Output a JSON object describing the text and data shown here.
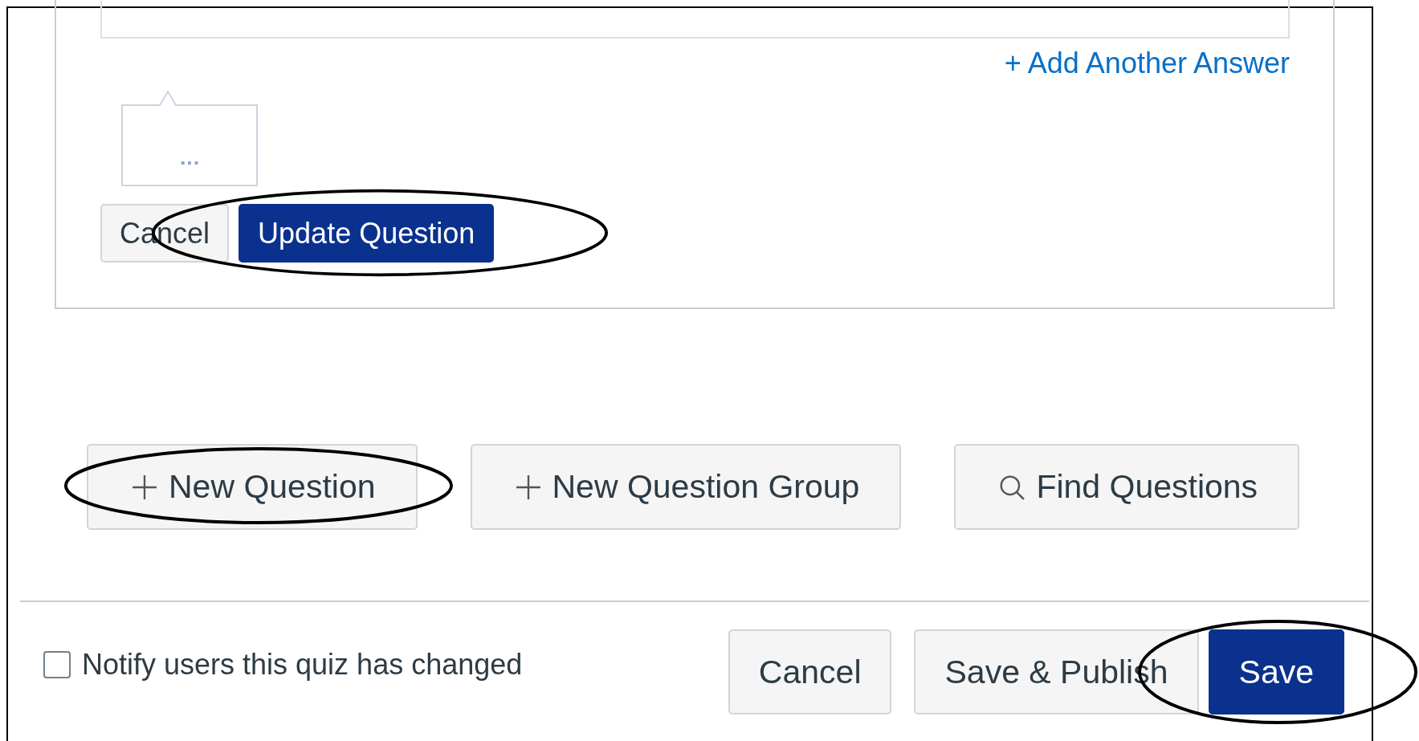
{
  "question_editor": {
    "add_answer_link": "+ Add Another Answer",
    "tooltip_text": "...",
    "buttons": [
      {
        "label": "Cancel",
        "kind": "secondary",
        "highlighted": false
      },
      {
        "label": "Update Question",
        "kind": "primary",
        "highlighted": true
      }
    ]
  },
  "question_actions": [
    {
      "label": "New Question",
      "kind": "add",
      "highlighted": true
    },
    {
      "label": "New Question Group",
      "kind": "add",
      "highlighted": false
    },
    {
      "label": "Find Questions",
      "kind": "search",
      "highlighted": false
    }
  ],
  "footer": {
    "notify": {
      "label": "Notify users this quiz has changed",
      "checked": false
    },
    "buttons": [
      {
        "label": "Cancel",
        "kind": "secondary",
        "highlighted": false
      },
      {
        "label": "Save & Publish",
        "kind": "secondary",
        "highlighted": false
      },
      {
        "label": "Save",
        "kind": "primary",
        "highlighted": true
      }
    ]
  }
}
